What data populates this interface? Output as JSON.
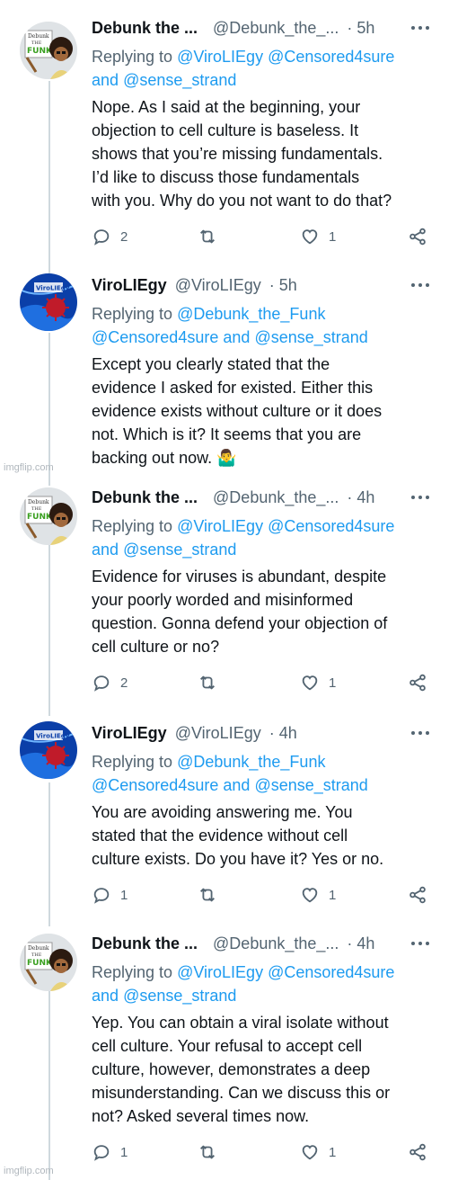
{
  "watermark": "imgflip.com",
  "icons": {
    "reply": "reply-icon",
    "retweet": "retweet-icon",
    "like": "heart-icon",
    "share": "share-icon",
    "more": "more-options-icon"
  },
  "colors": {
    "link": "#1d9bf0",
    "secondary_text": "#536471",
    "primary_text": "#0f1419"
  },
  "tweets": [
    {
      "display_name": "Debunk the ...",
      "handle": "@Debunk_the_...",
      "time": "· 5h",
      "replying_to_prefix": "Replying to",
      "mention_1": "@ViroLIEgy",
      "mention_2": "@Censored4sure",
      "and_text": "and",
      "mention_3": "@sense_strand",
      "text_lines": [
        "Nope. As I said at the beginning, your",
        "objection to cell culture is baseless. It",
        "shows that you’re missing fundamentals.",
        "I’d like to discuss those fundamentals",
        "with you. Why do you not want to do that?"
      ],
      "replies": "2",
      "likes": "1"
    },
    {
      "display_name": "ViroLIEgy",
      "handle": "@ViroLIEgy",
      "time": "· 5h",
      "replying_to_prefix": "Replying to",
      "mention_1": "@Debunk_the_Funk",
      "mention_2": "@Censored4sure",
      "and_text": "and",
      "mention_3": "@sense_strand",
      "text_lines": [
        "Except you clearly stated that the",
        "evidence I asked for existed. Either this",
        "evidence exists without culture or it does",
        "not. Which is it? It seems that you are",
        "backing out now. 🤷‍♂️"
      ]
    },
    {
      "display_name": "Debunk the ...",
      "handle": "@Debunk_the_...",
      "time": "· 4h",
      "replying_to_prefix": "Replying to",
      "mention_1": "@ViroLIEgy",
      "mention_2": "@Censored4sure",
      "and_text": "and",
      "mention_3": "@sense_strand",
      "text_lines": [
        "Evidence for viruses is abundant, despite",
        "your poorly worded and misinformed",
        "question. Gonna defend your objection of",
        "cell culture or no?"
      ],
      "replies": "2",
      "likes": "1"
    },
    {
      "display_name": "ViroLIEgy",
      "handle": "@ViroLIEgy",
      "time": "· 4h",
      "replying_to_prefix": "Replying to",
      "mention_1": "@Debunk_the_Funk",
      "mention_2": "@Censored4sure",
      "and_text": "and",
      "mention_3": "@sense_strand",
      "text_lines": [
        "You are avoiding answering me. You",
        "stated that the evidence without cell",
        "culture exists. Do you have it? Yes or no."
      ],
      "replies": "1",
      "likes": "1"
    },
    {
      "display_name": "Debunk the ...",
      "handle": "@Debunk_the_...",
      "time": "· 4h",
      "replying_to_prefix": "Replying to",
      "mention_1": "@ViroLIEgy",
      "mention_2": "@Censored4sure",
      "and_text": "and",
      "mention_3": "@sense_strand",
      "text_lines": [
        "Yep. You can obtain a viral isolate without",
        "cell culture. Your refusal to accept cell",
        "culture, however, demonstrates a deep",
        "misunderstanding. Can we discuss this or",
        "not? Asked several times now."
      ],
      "replies": "1",
      "likes": "1"
    }
  ]
}
